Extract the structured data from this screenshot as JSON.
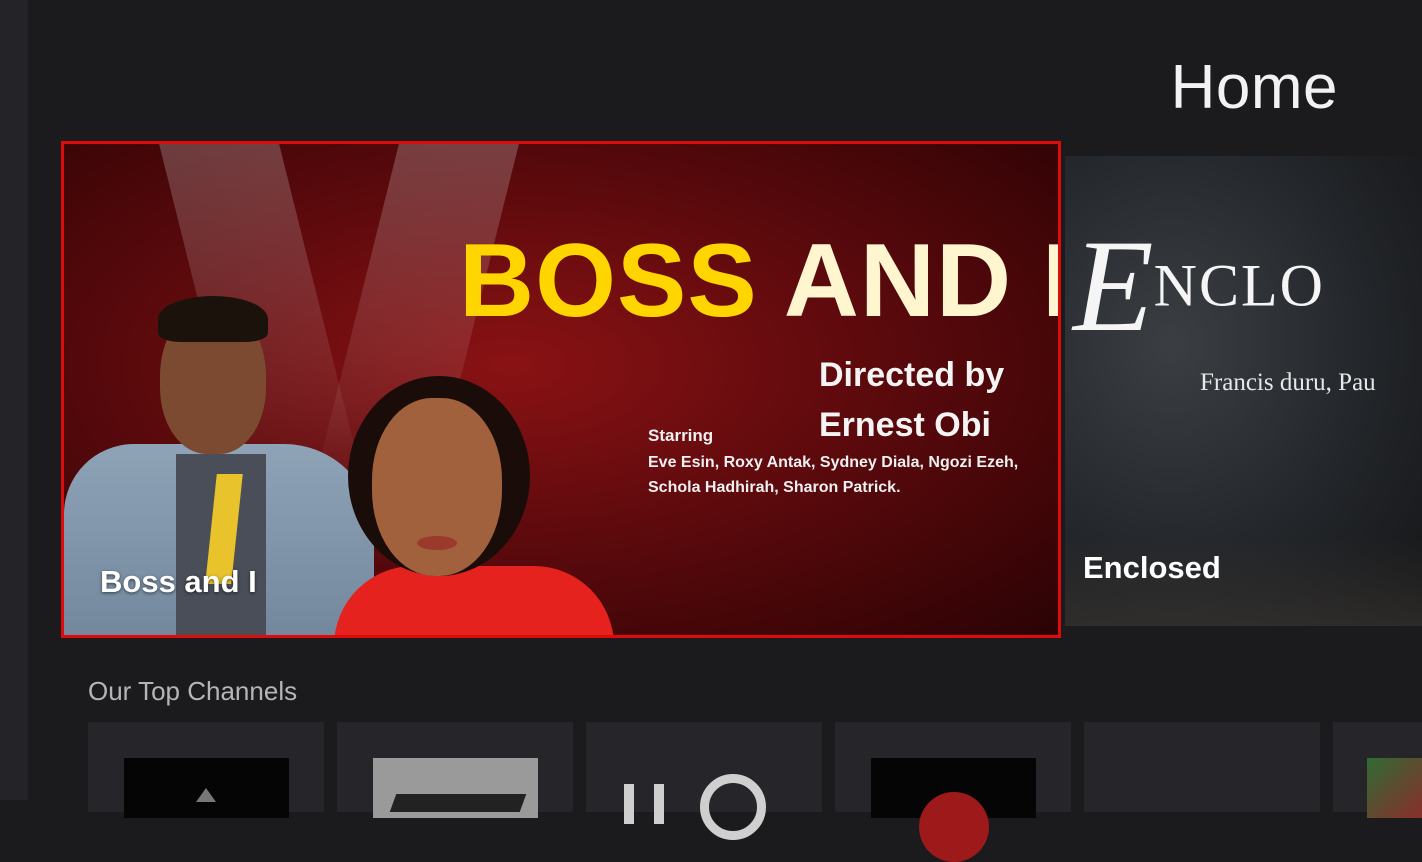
{
  "page": {
    "title": "Home"
  },
  "featured": [
    {
      "label": "Boss and I",
      "poster": {
        "title_word1": "BOSS",
        "title_word2": "AND I",
        "directed_line1": "Directed by",
        "directed_line2": "Ernest Obi",
        "starring_label": "Starring",
        "starring_names": "Eve Esin, Roxy Antak, Sydney Diala, Ngozi Ezeh, Schola Hadhirah, Sharon Patrick."
      },
      "focused": true,
      "border_color": "#e10a0a"
    },
    {
      "label": "Enclosed",
      "poster": {
        "logo_initial": "E",
        "logo_rest": "NCLO",
        "subtitle": "Francis duru, Pau"
      }
    }
  ],
  "sections": [
    {
      "title": "Our Top Channels",
      "channels": [
        {
          "icon": "channel-logo-dark-triangle"
        },
        {
          "icon": "channel-logo-gray-badge"
        },
        {
          "icon": "channel-logo-no-target"
        },
        {
          "icon": "channel-logo-red-circle"
        },
        {
          "icon": "channel-logo-blank"
        },
        {
          "icon": "channel-logo-thumbnail"
        }
      ]
    }
  ]
}
